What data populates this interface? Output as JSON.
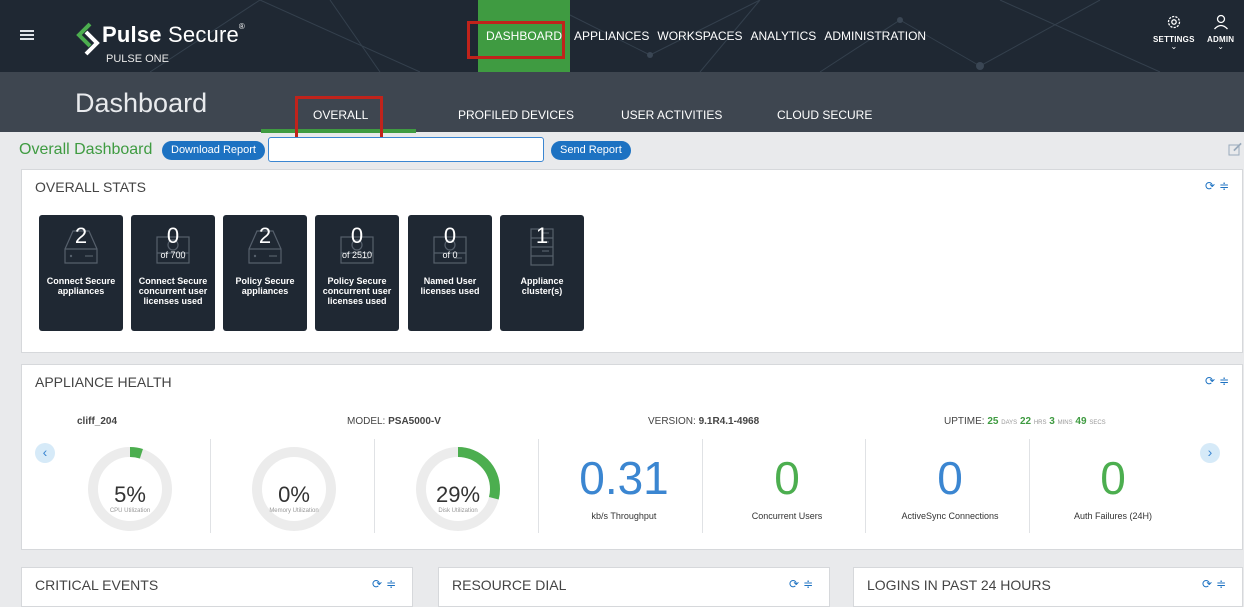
{
  "brand": {
    "name_bold": "Pulse",
    "name_thin": " Secure",
    "product": "PULSE ONE"
  },
  "nav": {
    "items": [
      {
        "label": "DASHBOARD",
        "active": true
      },
      {
        "label": "APPLIANCES"
      },
      {
        "label": "WORKSPACES"
      },
      {
        "label": "ANALYTICS"
      },
      {
        "label": "ADMINISTRATION"
      }
    ],
    "settings_label": "SETTINGS",
    "admin_label": "ADMIN"
  },
  "page": {
    "title": "Dashboard",
    "tabs": [
      {
        "label": "OVERALL",
        "active": true
      },
      {
        "label": "PROFILED DEVICES"
      },
      {
        "label": "USER ACTIVITIES"
      },
      {
        "label": "CLOUD SECURE"
      }
    ]
  },
  "toolbar": {
    "title": "Overall Dashboard",
    "download_label": "Download Report",
    "email_value": "",
    "send_label": "Send Report"
  },
  "overall_stats": {
    "title": "OVERALL STATS",
    "tiles": [
      {
        "value": "2",
        "of": "",
        "label": "Connect Secure appliances",
        "icon": "server-icon"
      },
      {
        "value": "0",
        "of": "of 700",
        "label": "Connect Secure concurrent user licenses used",
        "icon": "license-icon"
      },
      {
        "value": "2",
        "of": "",
        "label": "Policy Secure appliances",
        "icon": "server-icon"
      },
      {
        "value": "0",
        "of": "of 2510",
        "label": "Policy Secure concurrent user licenses used",
        "icon": "license-icon"
      },
      {
        "value": "0",
        "of": "of 0",
        "label": "Named User licenses used",
        "icon": "license-icon"
      },
      {
        "value": "1",
        "of": "",
        "label": "Appliance cluster(s)",
        "icon": "cluster-icon"
      }
    ]
  },
  "appliance_health": {
    "title": "APPLIANCE HEALTH",
    "name": "cliff_204",
    "model_key": "MODEL:",
    "model": "PSA5000-V",
    "version_key": "VERSION:",
    "version": "9.1R4.1-4968",
    "uptime_key": "UPTIME:",
    "uptime_days": "25",
    "uptime_days_unit": "DAYS",
    "uptime_hrs": "22",
    "uptime_hrs_unit": "HRS",
    "uptime_mins": "3",
    "uptime_mins_unit": "MINS",
    "uptime_secs": "49",
    "uptime_secs_unit": "SECS",
    "gauges": [
      {
        "value": "5%",
        "fraction": 0.05,
        "label": "CPU Utilization"
      },
      {
        "value": "0%",
        "fraction": 0.0,
        "label": "Memory Utilization"
      },
      {
        "value": "29%",
        "fraction": 0.29,
        "label": "Disk Utilization"
      }
    ],
    "metrics": [
      {
        "value": "0.31",
        "label": "kb/s Throughput",
        "color": "#3b86d1"
      },
      {
        "value": "0",
        "label": "Concurrent Users",
        "color": "#4cae4f"
      },
      {
        "value": "0",
        "label": "ActiveSync Connections",
        "color": "#3b86d1"
      },
      {
        "value": "0",
        "label": "Auth Failures (24H)",
        "color": "#4cae4f"
      }
    ]
  },
  "bottom_panels": [
    {
      "title": "CRITICAL EVENTS"
    },
    {
      "title": "RESOURCE DIAL"
    },
    {
      "title": "LOGINS IN PAST 24 HOURS"
    }
  ],
  "colors": {
    "accent_green": "#3f9b41",
    "accent_blue": "#1d72c2",
    "topbar": "#1f2833",
    "subbar": "#3e4650",
    "highlight_red": "#c0231b"
  }
}
